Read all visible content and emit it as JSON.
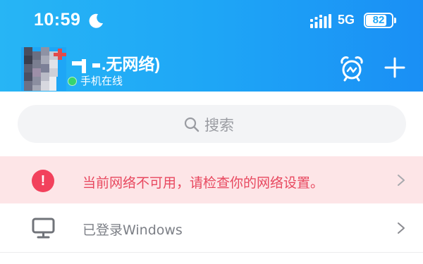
{
  "status_bar": {
    "time": "10:59",
    "moon_icon": "moon-icon",
    "signal_icon": "signal-bars-icon",
    "network": "5G",
    "battery": "82",
    "battery_level": 0.82
  },
  "header": {
    "nickname": ".无网络)",
    "online_status": "手机在线",
    "colors": {
      "gradient_start": "#27b5f5",
      "gradient_end": "#1a8ff5",
      "online": "#37d46e"
    },
    "actions": [
      "alarm-clock-icon",
      "plus-icon"
    ]
  },
  "search": {
    "placeholder": "搜索",
    "icon": "search-icon"
  },
  "alert": {
    "icon": "!",
    "message": "当前网络不可用，请检查你的网络设置。",
    "colors": {
      "background": "#fde5e7",
      "accent": "#f2415c",
      "text": "#e8485f"
    }
  },
  "login_device": {
    "icon": "monitor-icon",
    "label": "已登录Windows"
  }
}
